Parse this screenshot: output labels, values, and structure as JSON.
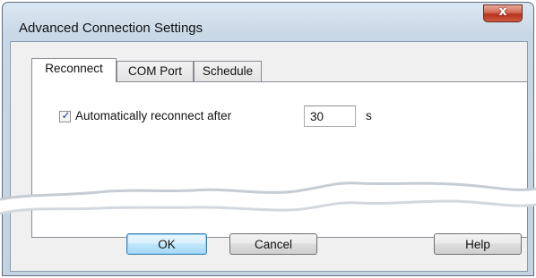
{
  "window": {
    "title": "Advanced Connection Settings",
    "close_symbol": "x"
  },
  "tabs": [
    {
      "label": "Reconnect",
      "active": true
    },
    {
      "label": "COM Port",
      "active": false
    },
    {
      "label": "Schedule",
      "active": false
    }
  ],
  "reconnect": {
    "checkbox_checked": true,
    "checkbox_symbol": "✓",
    "label": "Automatically reconnect after",
    "value": "30",
    "unit": "s"
  },
  "buttons": {
    "ok": "OK",
    "cancel": "Cancel",
    "help": "Help"
  },
  "colors": {
    "default_button_border": "#3c7fb1",
    "close_button": "#c8452d"
  }
}
